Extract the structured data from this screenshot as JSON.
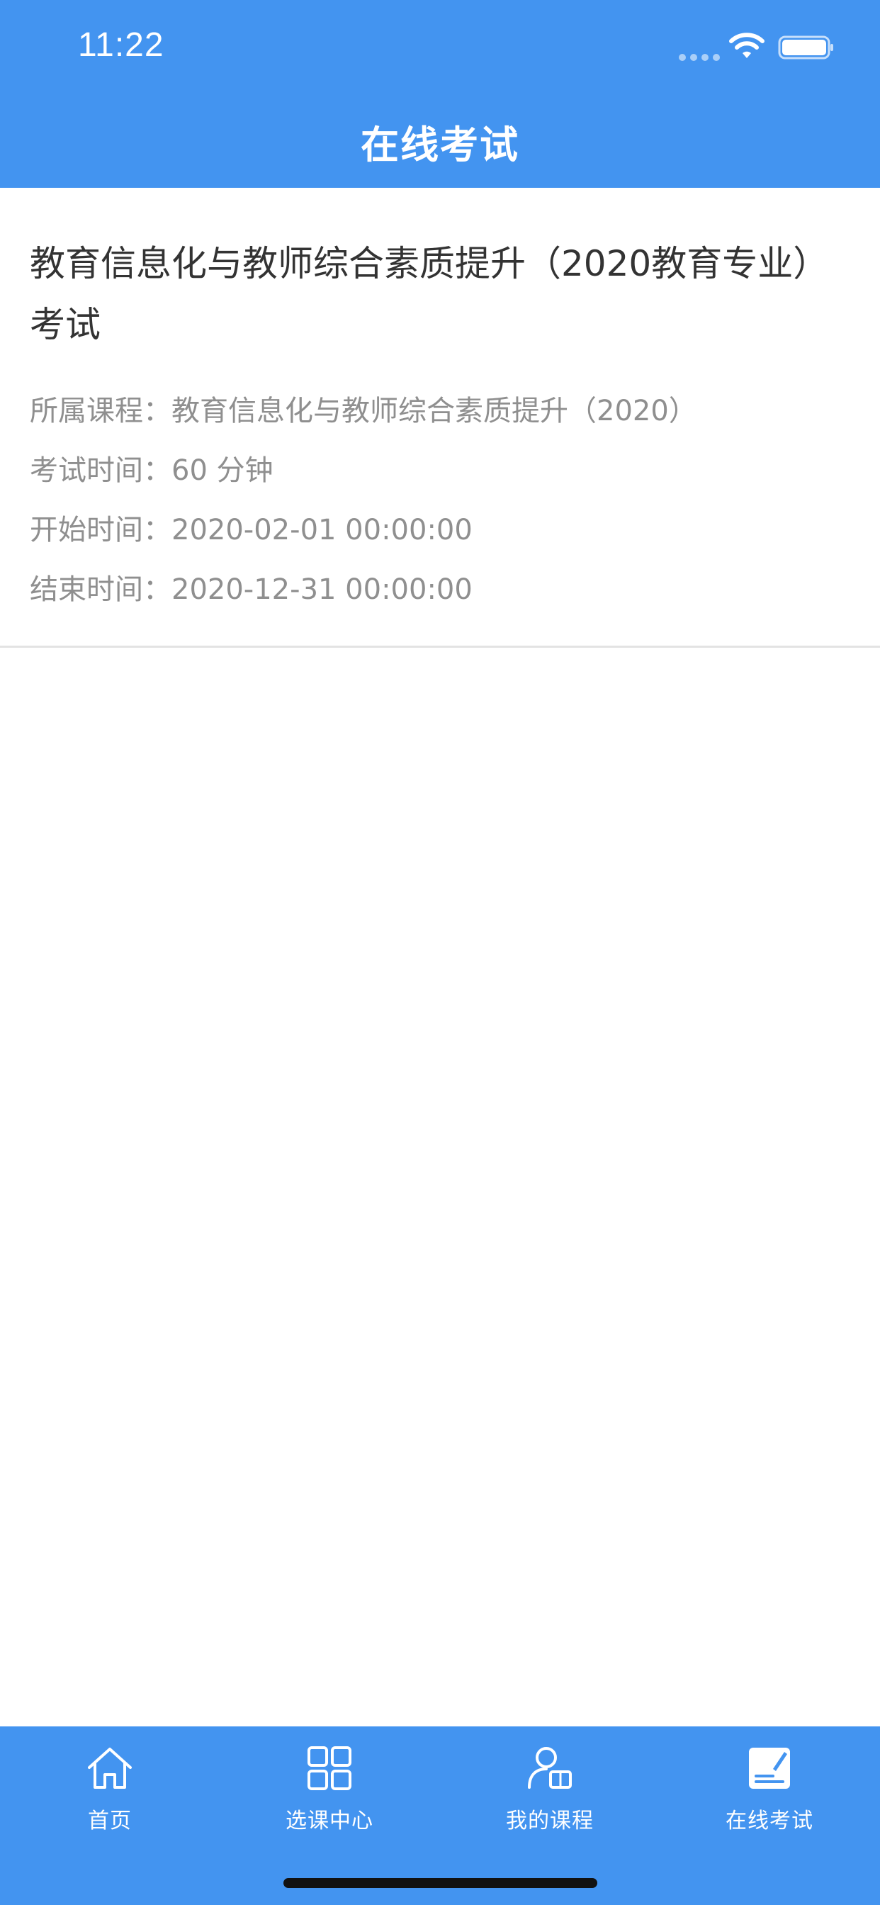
{
  "status_bar": {
    "time": "11:22"
  },
  "nav": {
    "title": "在线考试"
  },
  "exam": {
    "title": "教育信息化与教师综合素质提升（2020教育专业）考试",
    "course_label": "所属课程：",
    "course_value": "教育信息化与教师综合素质提升（2020）",
    "duration_label": "考试时间：",
    "duration_value": "60 分钟",
    "start_label": "开始时间：",
    "start_value": "2020-02-01 00:00:00",
    "end_label": "结束时间：",
    "end_value": "2020-12-31 00:00:00"
  },
  "tabbar": {
    "items": [
      {
        "label": "首页",
        "icon": "home-icon"
      },
      {
        "label": "选课中心",
        "icon": "grid-icon"
      },
      {
        "label": "我的课程",
        "icon": "user-book-icon"
      },
      {
        "label": "在线考试",
        "icon": "exam-note-icon"
      }
    ],
    "active_index": 3
  },
  "colors": {
    "primary": "#4394f0",
    "title_text": "#333333",
    "secondary_text": "#8f8f8f",
    "divider": "#e3e3e3"
  }
}
